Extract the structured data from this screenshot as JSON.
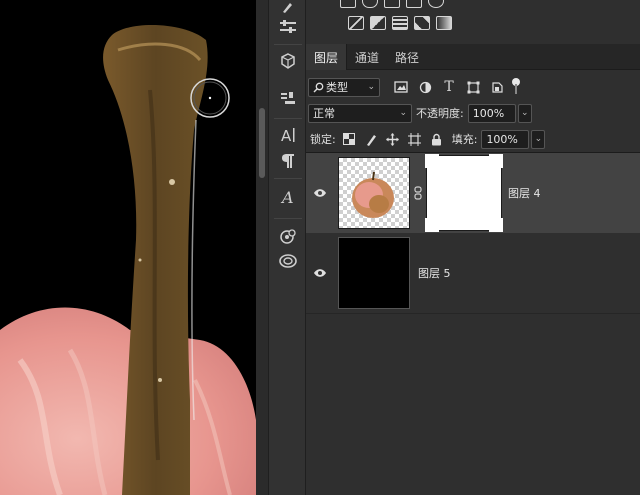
{
  "tabs": [
    "图层",
    "通道",
    "路径"
  ],
  "filter": {
    "kind_label": "类型",
    "chev": "⌄"
  },
  "blend": {
    "mode": "正常",
    "opacity_label": "不透明度:",
    "opacity_value": "100%"
  },
  "lock": {
    "label": "锁定:",
    "fill_label": "填充:",
    "fill_value": "100%"
  },
  "layers": [
    {
      "name": "图层 4",
      "visible": true,
      "selected": true,
      "has_mask": true
    },
    {
      "name": "图层 5",
      "visible": true,
      "selected": false,
      "has_mask": false
    }
  ],
  "icons": {
    "eye": "eye-icon",
    "link": "link-icon",
    "search": "search-icon",
    "type_tool": "type-tool-icon",
    "paragraph": "paragraph-icon",
    "glyphs": "glyphs-icon",
    "cloud": "creative-cloud-icon"
  },
  "colors": {
    "panel_bg": "#2f2f2f",
    "selected_row": "#434343",
    "canvas_bg": "#000000"
  }
}
